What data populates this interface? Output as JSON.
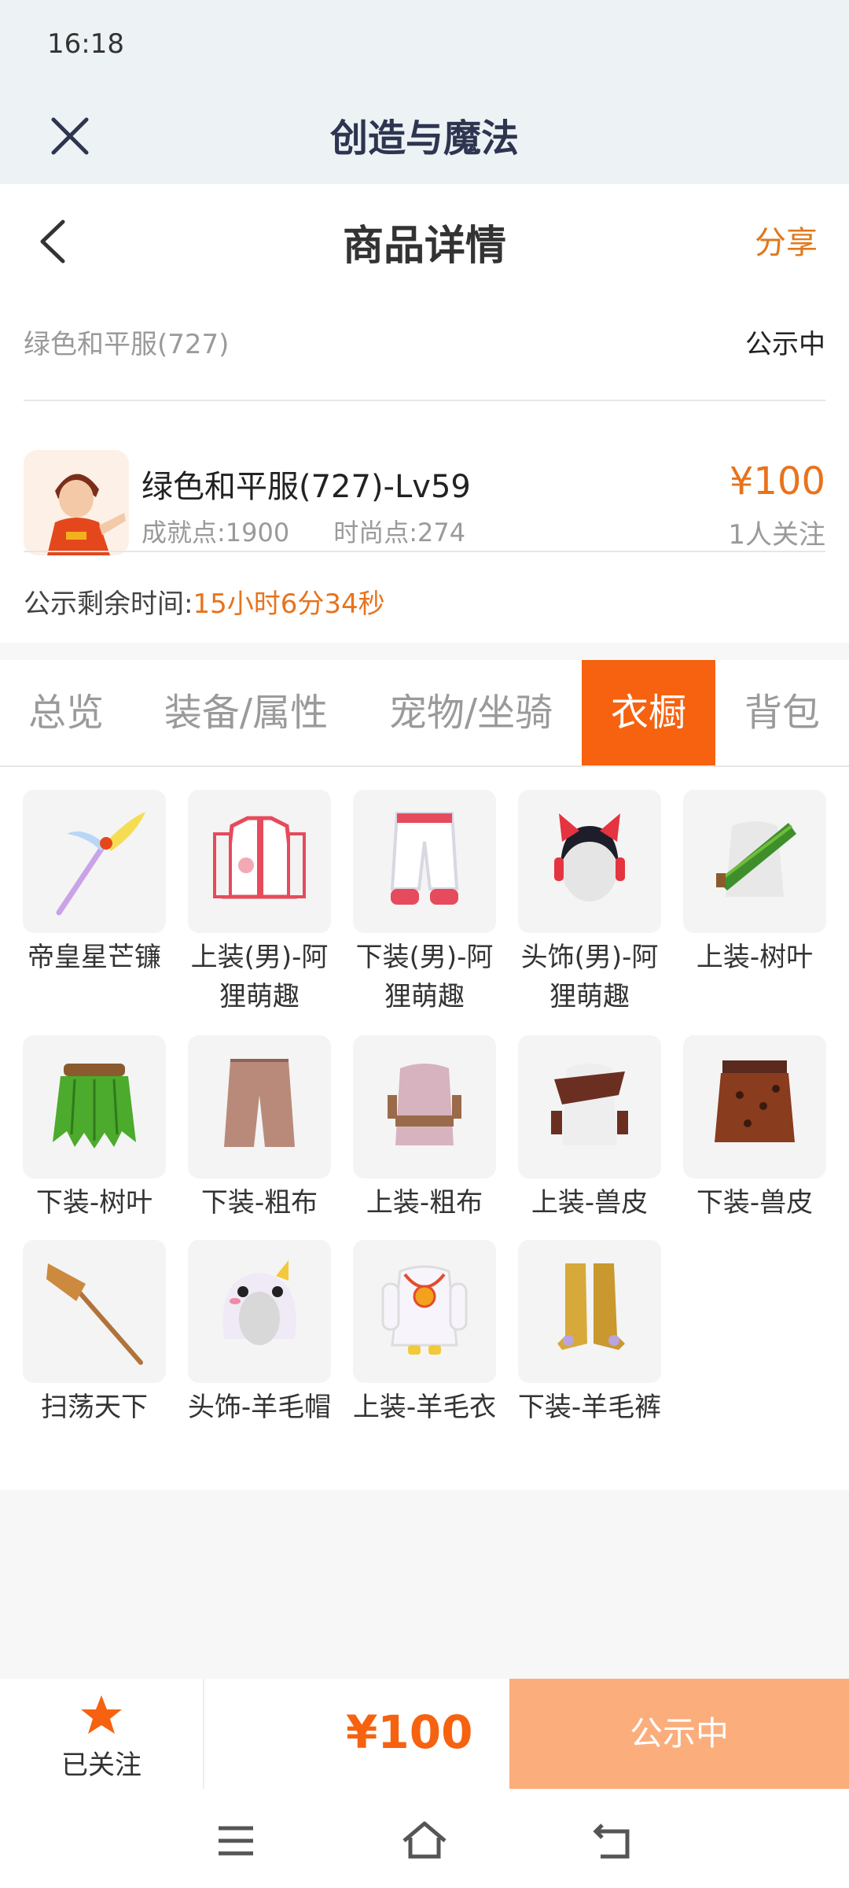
{
  "status": {
    "time": "16:18"
  },
  "appbar": {
    "title": "创造与魔法"
  },
  "nav": {
    "title": "商品详情",
    "share": "分享"
  },
  "meta": {
    "name": "绿色和平服(727)",
    "status": "公示中"
  },
  "product": {
    "name": "绿色和平服(727)-Lv59",
    "achievement": "成就点:1900",
    "fashion": "时尚点:274",
    "price": "¥100",
    "followers": "1人关注"
  },
  "remaining": {
    "label": "公示剩余时间:",
    "value": "15小时6分34秒"
  },
  "tabs": [
    {
      "label": "总览"
    },
    {
      "label": "装备/属性"
    },
    {
      "label": "宠物/坐骑"
    },
    {
      "label": "衣橱",
      "active": true
    },
    {
      "label": "背包"
    }
  ],
  "wardrobe": [
    {
      "label": "帝皇星芒镰",
      "icon": "scythe-icon"
    },
    {
      "label": "上装(男)-阿狸萌趣",
      "icon": "jacket-icon"
    },
    {
      "label": "下装(男)-阿狸萌趣",
      "icon": "pants-icon"
    },
    {
      "label": "头饰(男)-阿狸萌趣",
      "icon": "headwear-icon"
    },
    {
      "label": "上装-树叶",
      "icon": "leaf-top-icon"
    },
    {
      "label": "下装-树叶",
      "icon": "leaf-skirt-icon"
    },
    {
      "label": "下装-粗布",
      "icon": "cloth-shorts-icon"
    },
    {
      "label": "上装-粗布",
      "icon": "cloth-top-icon"
    },
    {
      "label": "上装-兽皮",
      "icon": "hide-top-icon"
    },
    {
      "label": "下装-兽皮",
      "icon": "hide-skirt-icon"
    },
    {
      "label": "扫荡天下",
      "icon": "broom-icon"
    },
    {
      "label": "头饰-羊毛帽",
      "icon": "wool-hat-icon"
    },
    {
      "label": "上装-羊毛衣",
      "icon": "wool-top-icon"
    },
    {
      "label": "下装-羊毛裤",
      "icon": "wool-boots-icon"
    }
  ],
  "bottom": {
    "follow": "已关注",
    "price": "¥100",
    "status": "公示中"
  },
  "colors": {
    "accent": "#f6620f",
    "price": "#e8731c",
    "status_button": "#fbad7c"
  }
}
